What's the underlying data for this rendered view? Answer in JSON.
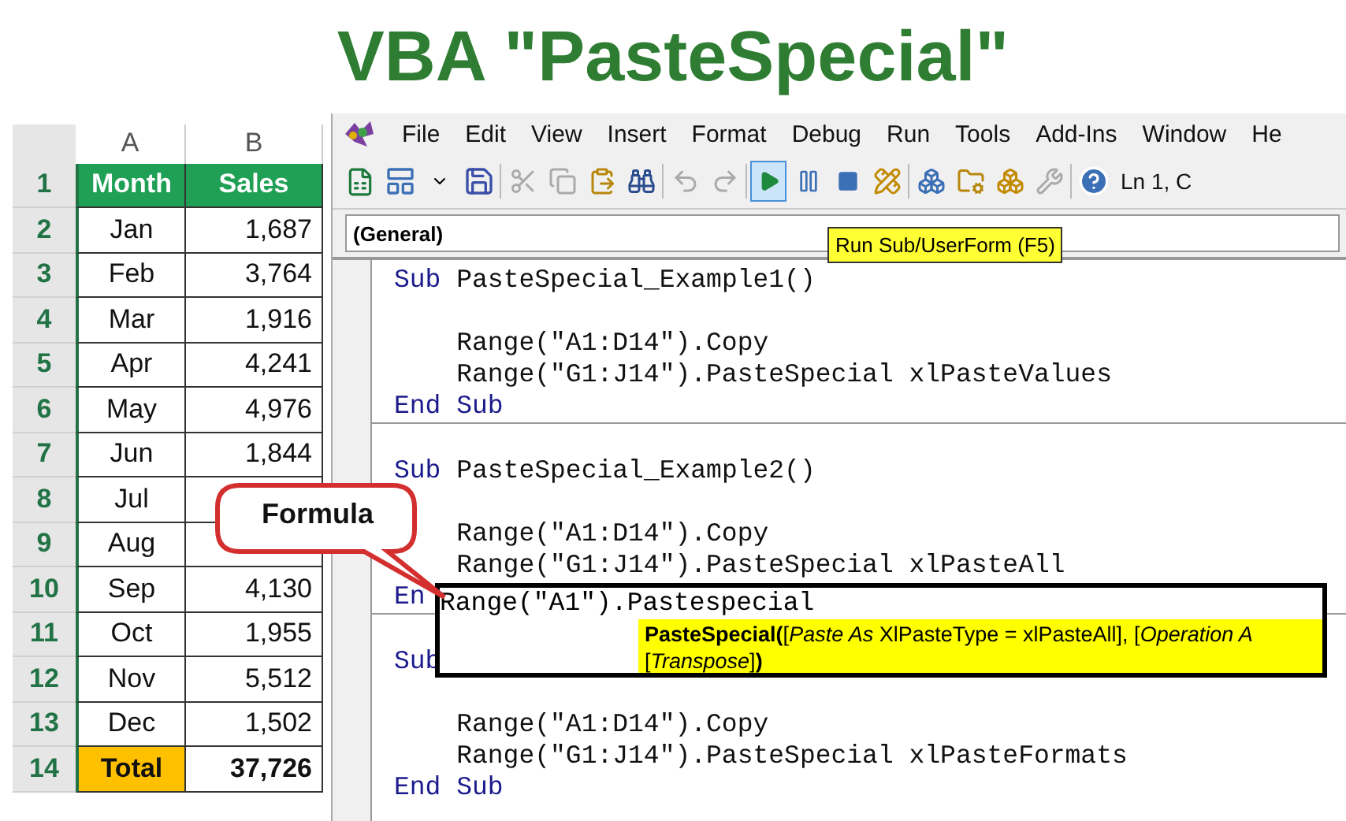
{
  "title": "VBA \"PasteSpecial\"",
  "sheet": {
    "columns": [
      "A",
      "B"
    ],
    "rows": [
      {
        "number": "1",
        "kind": "header",
        "month": "Month",
        "sales": "Sales"
      },
      {
        "number": "2",
        "kind": "data",
        "month": "Jan",
        "sales": "1,687"
      },
      {
        "number": "3",
        "kind": "data",
        "month": "Feb",
        "sales": "3,764"
      },
      {
        "number": "4",
        "kind": "data",
        "month": "Mar",
        "sales": "1,916"
      },
      {
        "number": "5",
        "kind": "data",
        "month": "Apr",
        "sales": "4,241"
      },
      {
        "number": "6",
        "kind": "data",
        "month": "May",
        "sales": "4,976"
      },
      {
        "number": "7",
        "kind": "data",
        "month": "Jun",
        "sales": "1,844"
      },
      {
        "number": "8",
        "kind": "data",
        "month": "Jul"
      },
      {
        "number": "9",
        "kind": "data",
        "month": "Aug"
      },
      {
        "number": "10",
        "kind": "data",
        "month": "Sep",
        "sales": "4,130"
      },
      {
        "number": "11",
        "kind": "data",
        "month": "Oct",
        "sales": "1,955"
      },
      {
        "number": "12",
        "kind": "data",
        "month": "Nov",
        "sales": "5,512"
      },
      {
        "number": "13",
        "kind": "data",
        "month": "Dec",
        "sales": "1,502"
      },
      {
        "number": "14",
        "kind": "total",
        "month": "Total",
        "sales": "37,726"
      }
    ]
  },
  "editor": {
    "menu": [
      "File",
      "Edit",
      "View",
      "Insert",
      "Format",
      "Debug",
      "Run",
      "Tools",
      "Add-Ins",
      "Window",
      "He"
    ],
    "toolbar": {
      "run_highlighted": true,
      "position": "Ln 1, C"
    },
    "object_dropdown": "(General)",
    "tooltip": "Run Sub/UserForm (F5)",
    "code": [
      {
        "kind": "code",
        "keyword": "Sub",
        "text": " PasteSpecial_Example1()"
      },
      {
        "kind": "blank"
      },
      {
        "kind": "code",
        "text": "    Range(\"A1:D14\").Copy"
      },
      {
        "kind": "code",
        "text": "    Range(\"G1:J14\").PasteSpecial xlPasteValues"
      },
      {
        "kind": "code",
        "keyword": "End Sub"
      },
      {
        "kind": "divider"
      },
      {
        "kind": "blank"
      },
      {
        "kind": "code",
        "keyword": "Sub",
        "text": " PasteSpecial_Example2()"
      },
      {
        "kind": "blank"
      },
      {
        "kind": "code",
        "text": "    Range(\"A1:D14\").Copy"
      },
      {
        "kind": "code",
        "text": "    Range(\"G1:J14\").PasteSpecial xlPasteAll"
      },
      {
        "kind": "code",
        "keyword": "En"
      },
      {
        "kind": "divider"
      },
      {
        "kind": "blank"
      },
      {
        "kind": "code",
        "keyword": "Sub"
      },
      {
        "kind": "blank"
      },
      {
        "kind": "code",
        "text": "    Range(\"A1:D14\").Copy"
      },
      {
        "kind": "code",
        "text": "    Range(\"G1:J14\").PasteSpecial xlPasteFormats"
      },
      {
        "kind": "code",
        "keyword": "End Sub"
      }
    ],
    "zoom_box": {
      "code": "Range(\"A1\").Pastespecial",
      "hint": [
        "**PasteSpecial(**[*Paste As* XlPasteType = xlPasteAll], [*Operation A*",
        "[*Transpose*]**)**"
      ]
    }
  },
  "callout": "Formula"
}
